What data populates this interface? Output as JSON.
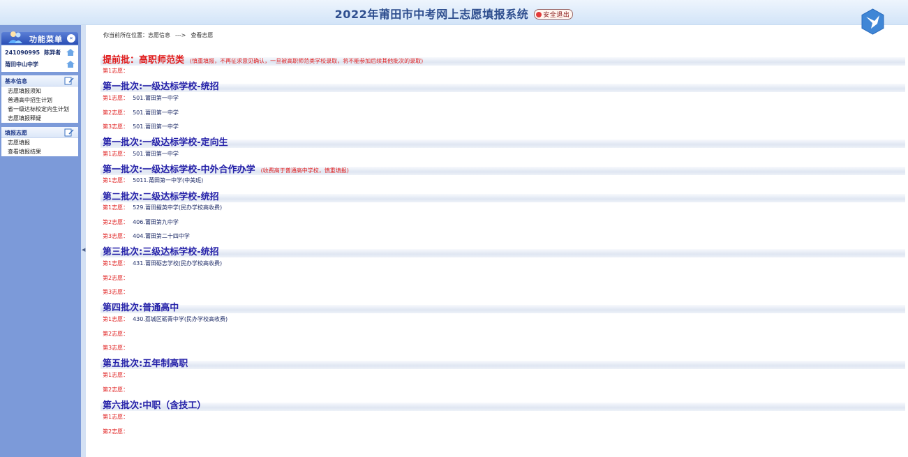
{
  "header": {
    "title": "2022年莆田市中考网上志愿填报系统",
    "logout_label": "安全退出"
  },
  "sidebar": {
    "menu_title": "功能菜单",
    "user": {
      "id": "241090995",
      "name": "陈羿者",
      "school": "莆田中山中学"
    },
    "sections": [
      {
        "title": "基本信息",
        "items": [
          "志愿填报须知",
          "普通高中招生计划",
          "省一级达标校定向生计划",
          "志愿填报释疑"
        ]
      },
      {
        "title": "填报志愿",
        "items": [
          "志愿填报",
          "查看填报结果"
        ]
      }
    ]
  },
  "breadcrumb": {
    "prefix": "你当前所在位置：志愿信息",
    "sep": "--->",
    "current": "查看志愿"
  },
  "batches": [
    {
      "title": "提前批：高职师范类",
      "note": "(慎重填报，不再征求意见确认，一旦被高职师范类学校录取，将不能参加后续其他批次的录取)",
      "choices": [
        {
          "label": "第1志愿：",
          "value": ""
        }
      ]
    },
    {
      "title": "第一批次:一级达标学校-统招",
      "note": "",
      "choices": [
        {
          "label": "第1志愿：",
          "value": "501.莆田第一中学"
        },
        {
          "label": "第2志愿：",
          "value": "501.莆田第一中学"
        },
        {
          "label": "第3志愿：",
          "value": "501.莆田第一中学"
        }
      ]
    },
    {
      "title": "第一批次:一级达标学校-定向生",
      "note": "",
      "choices": [
        {
          "label": "第1志愿：",
          "value": "501.莆田第一中学"
        }
      ]
    },
    {
      "title": "第一批次:一级达标学校-中外合作办学",
      "note": "(收费高于普通高中学校，慎重填报)",
      "choices": [
        {
          "label": "第1志愿：",
          "value": "5011.莆田第一中学(中美班)"
        }
      ]
    },
    {
      "title": "第二批次:二级达标学校-统招",
      "note": "",
      "choices": [
        {
          "label": "第1志愿：",
          "value": "529.莆田擢英中学(民办学校高收费)"
        },
        {
          "label": "第2志愿：",
          "value": "406.莆田第九中学"
        },
        {
          "label": "第3志愿：",
          "value": "404.莆田第二十四中学"
        }
      ]
    },
    {
      "title": "第三批次:三级达标学校-统招",
      "note": "",
      "choices": [
        {
          "label": "第1志愿：",
          "value": "431.莆田砺志学校(民办学校高收费)"
        },
        {
          "label": "第2志愿：",
          "value": ""
        },
        {
          "label": "第3志愿：",
          "value": ""
        }
      ]
    },
    {
      "title": "第四批次:普通高中",
      "note": "",
      "choices": [
        {
          "label": "第1志愿：",
          "value": "430.荔城区砺青中学(民办学校高收费)"
        },
        {
          "label": "第2志愿：",
          "value": ""
        },
        {
          "label": "第3志愿：",
          "value": ""
        }
      ]
    },
    {
      "title": "第五批次:五年制高职",
      "note": "",
      "choices": [
        {
          "label": "第1志愿：",
          "value": ""
        },
        {
          "label": "第2志愿：",
          "value": ""
        }
      ]
    },
    {
      "title": "第六批次:中职（含技工）",
      "note": "",
      "choices": [
        {
          "label": "第1志愿：",
          "value": ""
        },
        {
          "label": "第2志愿：",
          "value": ""
        }
      ]
    }
  ]
}
